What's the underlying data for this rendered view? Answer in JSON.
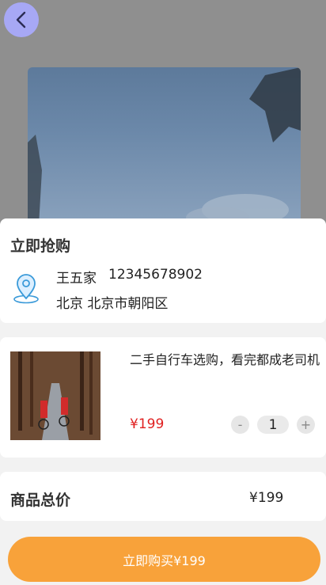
{
  "colors": {
    "accent": "#f8a23a",
    "price": "#e02020",
    "back_button": "#a7a8f5"
  },
  "header": {
    "back_icon": "chevron-left-icon"
  },
  "section": {
    "title": "立即抢购"
  },
  "address": {
    "icon": "location-pin-icon",
    "name": "王五家",
    "phone": "12345678902",
    "line": "北京 北京市朝阳区"
  },
  "product": {
    "name": "二手自行车选购，看完都成老司机",
    "price": "¥199",
    "quantity": "1",
    "minus_label": "-",
    "plus_label": "+"
  },
  "total": {
    "label": "商品总价",
    "value": "¥199"
  },
  "buy_button": {
    "label": "立即购买¥199"
  }
}
